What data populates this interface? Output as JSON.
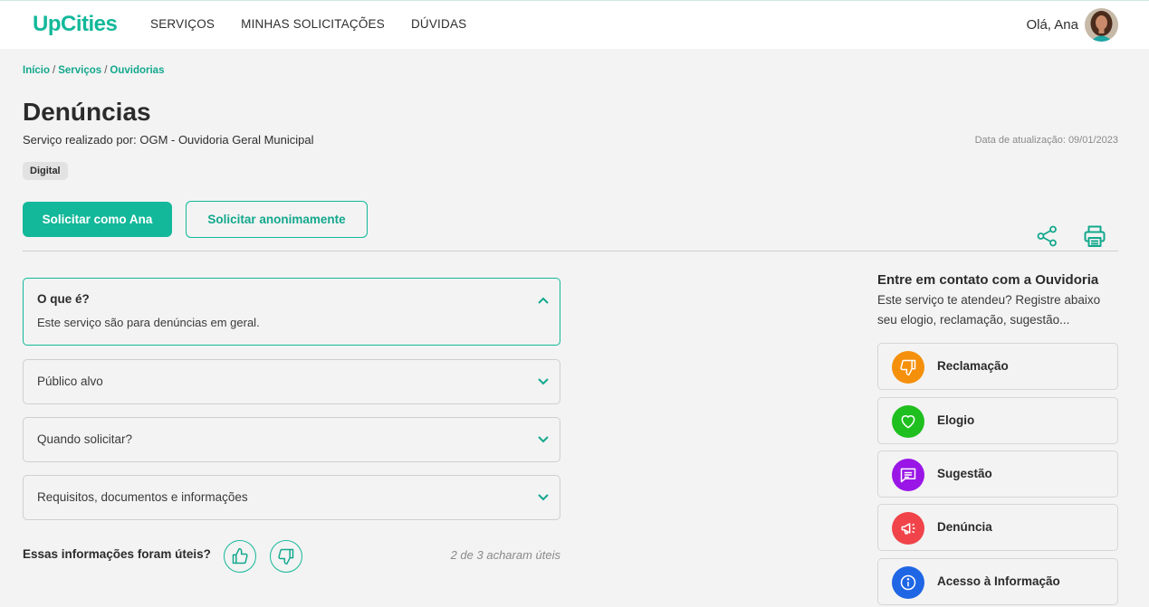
{
  "header": {
    "logo": "UpCities",
    "nav": [
      "SERVIÇOS",
      "MINHAS SOLICITAÇÕES",
      "DÚVIDAS"
    ],
    "greeting": "Olá, Ana"
  },
  "breadcrumb": [
    "Início",
    "Serviços",
    "Ouvidorias"
  ],
  "service": {
    "title": "Denúncias",
    "provider": "Serviço realizado por: OGM - Ouvidoria Geral Municipal",
    "updated": "Data de atualização: 09/01/2023",
    "tag": "Digital"
  },
  "actions": {
    "primary": "Solicitar como Ana",
    "secondary": "Solicitar anonimamente"
  },
  "accordion": [
    {
      "label": "O que é?",
      "content": "Este serviço são para denúncias em geral.",
      "open": true
    },
    {
      "label": "Público alvo",
      "open": false
    },
    {
      "label": "Quando solicitar?",
      "open": false
    },
    {
      "label": "Requisitos, documentos e informações",
      "open": false
    }
  ],
  "feedback": {
    "question": "Essas informações foram úteis?",
    "stats": "2 de 3 acharam úteis"
  },
  "contact": {
    "title": "Entre em contato com a Ouvidoria",
    "description": "Este serviço te atendeu? Registre abaixo seu elogio, reclamação, sugestão...",
    "options": [
      {
        "label": "Reclamação",
        "icon": "thumbs-down-icon",
        "color": "#f5900c"
      },
      {
        "label": "Elogio",
        "icon": "heart-icon",
        "color": "#1fbf1f"
      },
      {
        "label": "Sugestão",
        "icon": "message-icon",
        "color": "#9a16e6"
      },
      {
        "label": "Denúncia",
        "icon": "megaphone-icon",
        "color": "#f0444a"
      },
      {
        "label": "Acesso à Informação",
        "icon": "info-icon",
        "color": "#1f66e5"
      }
    ]
  },
  "colors": {
    "accent": "#13b89a",
    "background": "#f3f3f3"
  }
}
